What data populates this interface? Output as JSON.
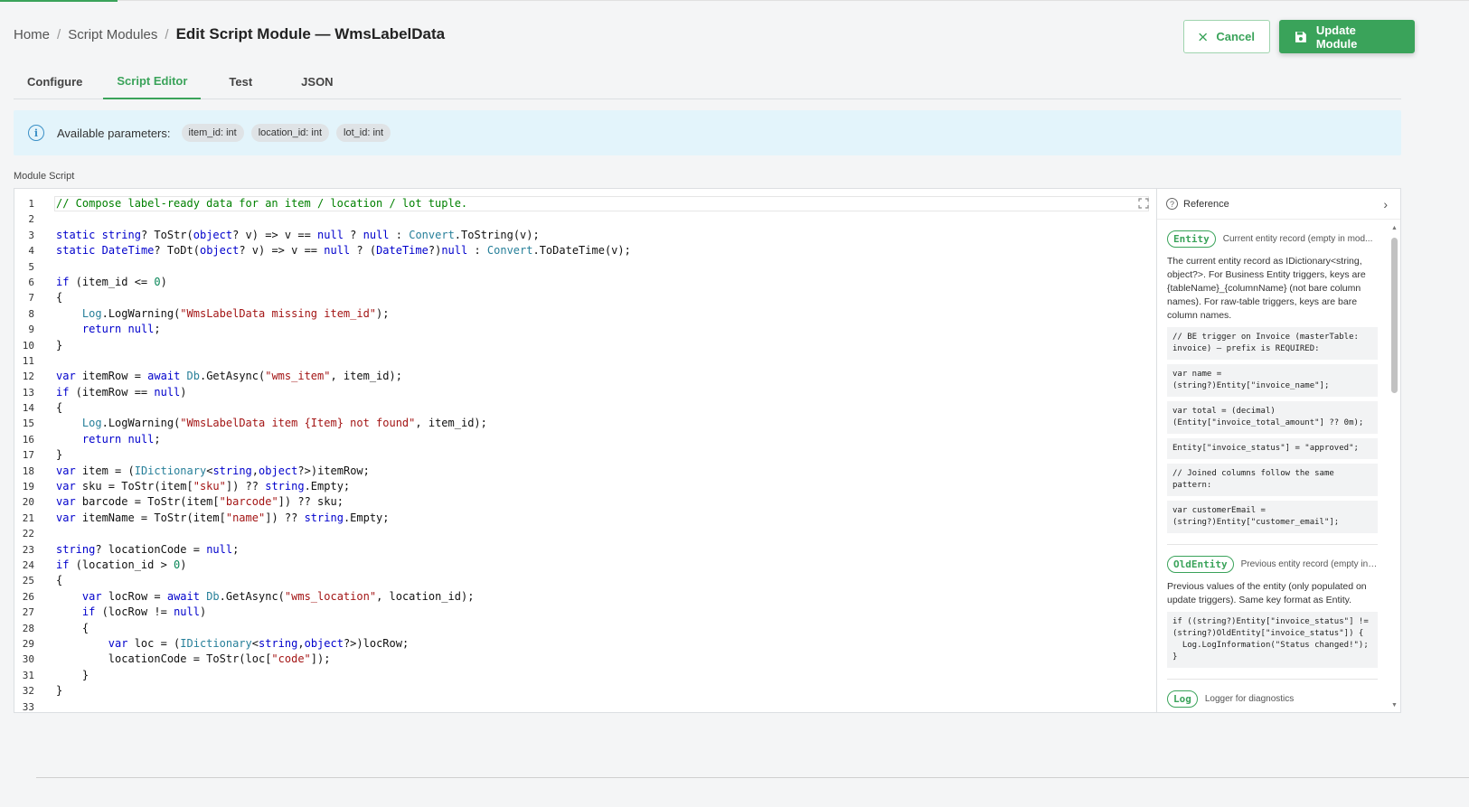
{
  "breadcrumb": {
    "home": "Home",
    "parent": "Script Modules",
    "current": "Edit Script Module — WmsLabelData",
    "sep": "/"
  },
  "actions": {
    "cancel": "Cancel",
    "update": "Update Module"
  },
  "tabs": [
    {
      "label": "Configure"
    },
    {
      "label": "Script Editor"
    },
    {
      "label": "Test"
    },
    {
      "label": "JSON"
    }
  ],
  "params": {
    "label": "Available parameters:",
    "items": [
      "item_id: int",
      "location_id: int",
      "lot_id: int"
    ]
  },
  "editor": {
    "section_label": "Module Script",
    "lines": [
      "// Compose label-ready data for an item / location / lot tuple.",
      "",
      "static string? ToStr(object? v) => v == null ? null : Convert.ToString(v);",
      "static DateTime? ToDt(object? v) => v == null ? (DateTime?)null : Convert.ToDateTime(v);",
      "",
      "if (item_id <= 0)",
      "{",
      "    Log.LogWarning(\"WmsLabelData missing item_id\");",
      "    return null;",
      "}",
      "",
      "var itemRow = await Db.GetAsync(\"wms_item\", item_id);",
      "if (itemRow == null)",
      "{",
      "    Log.LogWarning(\"WmsLabelData item {Item} not found\", item_id);",
      "    return null;",
      "}",
      "var item = (IDictionary<string,object?>)itemRow;",
      "var sku = ToStr(item[\"sku\"]) ?? string.Empty;",
      "var barcode = ToStr(item[\"barcode\"]) ?? sku;",
      "var itemName = ToStr(item[\"name\"]) ?? string.Empty;",
      "",
      "string? locationCode = null;",
      "if (location_id > 0)",
      "{",
      "    var locRow = await Db.GetAsync(\"wms_location\", location_id);",
      "    if (locRow != null)",
      "    {",
      "        var loc = (IDictionary<string,object?>)locRow;",
      "        locationCode = ToStr(loc[\"code\"]);",
      "    }",
      "}",
      ""
    ]
  },
  "reference": {
    "title": "Reference",
    "entries": [
      {
        "badge": "Entity",
        "short": "Current entity record (empty in mod...",
        "text": "The current entity record as IDictionary<string, object?>. For Business Entity triggers, keys are {tableName}_{columnName} (not bare column names). For raw-table triggers, keys are bare column names.",
        "snippets": [
          "// BE trigger on Invoice (masterTable: invoice) — prefix is REQUIRED:",
          "var name = (string?)Entity[\"invoice_name\"];",
          "var total = (decimal)(Entity[\"invoice_total_amount\"] ?? 0m);",
          "Entity[\"invoice_status\"] = \"approved\";",
          "// Joined columns follow the same pattern:",
          "var customerEmail = (string?)Entity[\"customer_email\"];"
        ]
      },
      {
        "badge": "OldEntity",
        "short": "Previous entity record (empty in ...",
        "text": "Previous values of the entity (only populated on update triggers). Same key format as Entity.",
        "snippets": [
          "if ((string?)Entity[\"invoice_status\"] != (string?)OldEntity[\"invoice_status\"]) {\n  Log.LogInformation(\"Status changed!\");\n}"
        ]
      },
      {
        "badge": "Log",
        "short": "Logger for diagnostics",
        "text": "",
        "snippets": []
      }
    ]
  },
  "colors": {
    "accent": "#3aa35a",
    "info_bg": "#e3f4fb",
    "keyword": "#0000cc",
    "string": "#a31515",
    "comment": "#008000",
    "type": "#267f99"
  }
}
